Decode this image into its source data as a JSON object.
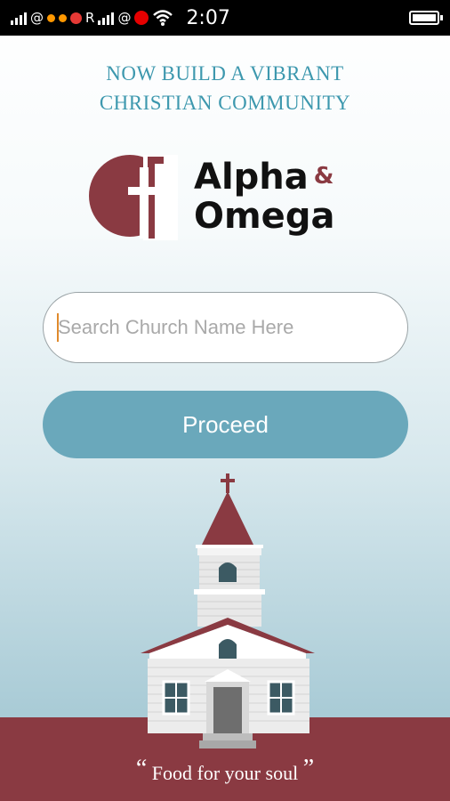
{
  "status_bar": {
    "carrier_marks": [
      "@",
      "R",
      "@"
    ],
    "time": "2:07",
    "icons": [
      "signal-icon",
      "wifi-icon",
      "battery-icon"
    ]
  },
  "tagline": {
    "line1": "NOW BUILD A VIBRANT",
    "line2": "CHRISTIAN COMMUNITY"
  },
  "logo": {
    "line1": "Alpha",
    "amp": "&",
    "line2": "Omega"
  },
  "search": {
    "placeholder": "Search Church Name Here",
    "value": ""
  },
  "proceed_label": "Proceed",
  "footer": {
    "open_quote": "“",
    "text": "Food for your soul",
    "close_quote": "”"
  },
  "colors": {
    "accent_teal": "#3d98ae",
    "button": "#6aa8bb",
    "brand_maroon": "#8a3a42"
  }
}
